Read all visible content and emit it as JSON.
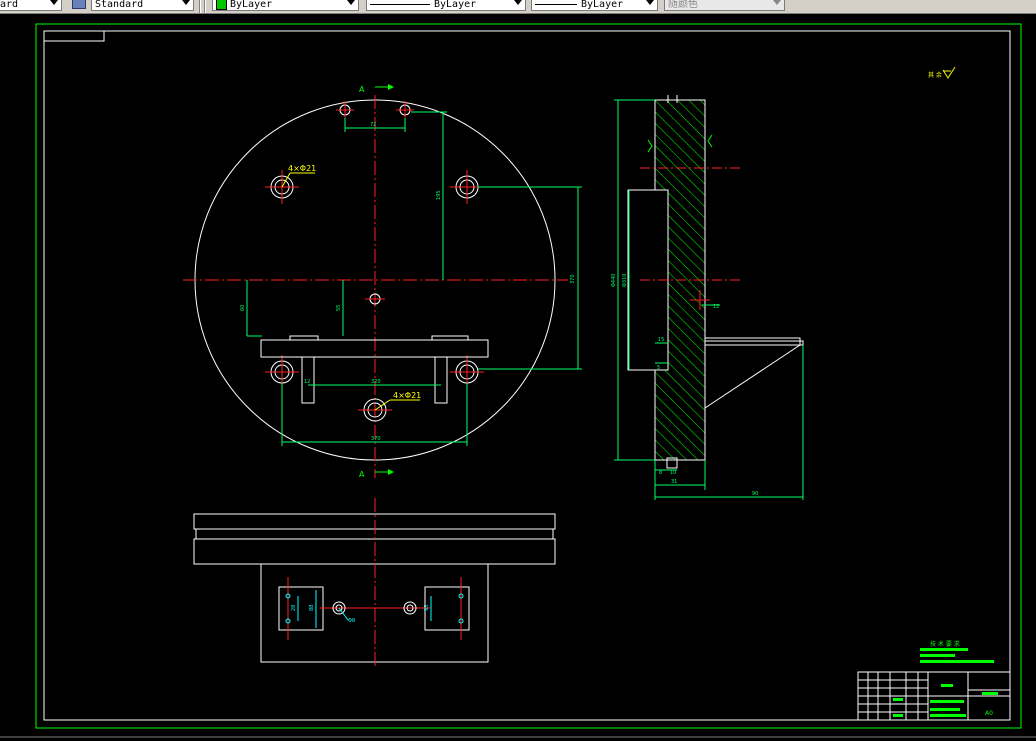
{
  "toolbar": {
    "text_style_partial": "ard",
    "dim_style": "Standard",
    "layer": "ByLayer",
    "linetype": "ByLayer",
    "lineweight": "ByLayer",
    "color": "随颜色"
  },
  "drawing": {
    "section_marker_top": "A",
    "section_marker_bottom": "A",
    "holes_label_top": "4×Φ21",
    "holes_label_bottom": "4×Φ21",
    "roughness_note": "其 余",
    "tech_req_title": "技 术 要 求",
    "sheet_size": "A0",
    "dims": {
      "top_spacing": "72",
      "vertical_right": "370",
      "vertical_mid": "195",
      "left_vertical_1": "60",
      "left_vertical_2": "55",
      "bottom_width_1": "320",
      "bottom_width_2": "370",
      "bottom_small": "12",
      "side_height": "Φ440",
      "side_inner": "Φ310",
      "side_step": "5",
      "side_foot_1": "8",
      "side_foot_2": "10",
      "side_base_1": "31",
      "side_base_2": "90",
      "side_hole": "12",
      "side_small": "15",
      "plan_1": "28",
      "plan_2": "88",
      "plan_3": "95",
      "plan_4": "Φ8"
    }
  },
  "colors": {
    "background": "#000000",
    "outline": "#ffffff",
    "border": "#00ff00",
    "centerline": "#ff2020",
    "dimension": "#00ff66",
    "hatch": "#00ff00",
    "annotation": "#ffff00",
    "hole_detail": "#00ffff"
  }
}
